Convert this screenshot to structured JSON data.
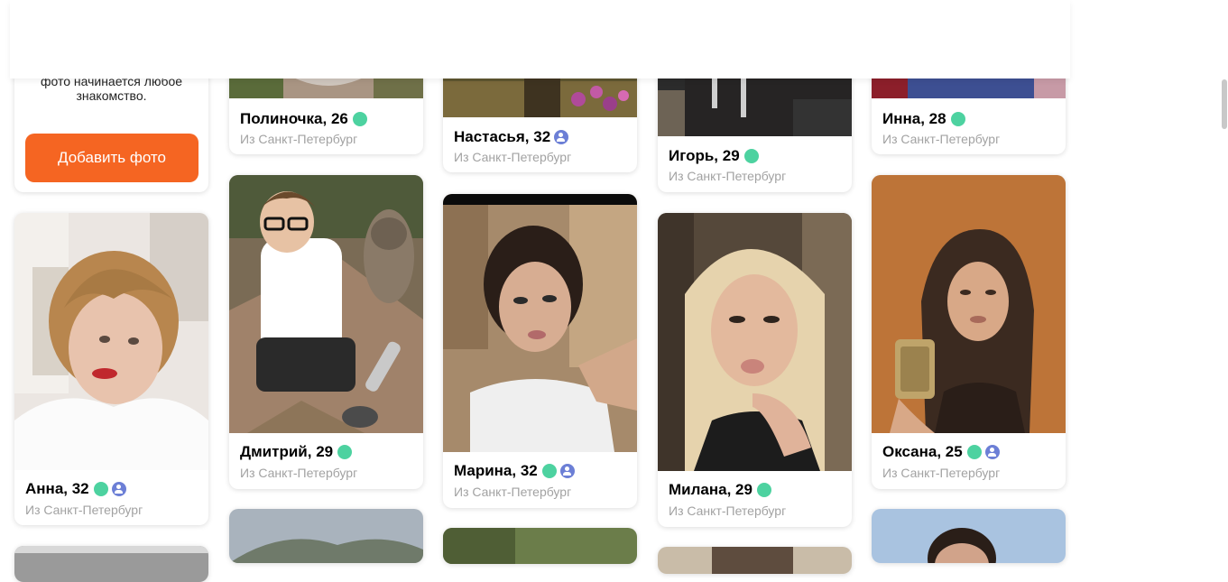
{
  "add_photo": {
    "text": "фото начинается любое знакомство.",
    "button_label": "Добавить фото"
  },
  "profiles": [
    {
      "name": "Полиночка, 26",
      "city": "Из Санкт-Петербург",
      "online": true,
      "verified": false
    },
    {
      "name": "Настасья, 32",
      "city": "Из Санкт-Петербург",
      "online": false,
      "verified": true
    },
    {
      "name": "Игорь, 29",
      "city": "Из Санкт-Петербург",
      "online": true,
      "verified": false
    },
    {
      "name": "Инна, 28",
      "city": "Из Санкт-Петербург",
      "online": true,
      "verified": false
    },
    {
      "name": "Анна, 32",
      "city": "Из Санкт-Петербург",
      "online": true,
      "verified": true
    },
    {
      "name": "Дмитрий, 29",
      "city": "Из Санкт-Петербург",
      "online": true,
      "verified": false
    },
    {
      "name": "Марина, 32",
      "city": "Из Санкт-Петербург",
      "online": true,
      "verified": true
    },
    {
      "name": "Милана, 29",
      "city": "Из Санкт-Петербург",
      "online": true,
      "verified": false
    },
    {
      "name": "Оксана, 25",
      "city": "Из Санкт-Петербург",
      "online": true,
      "verified": true
    }
  ],
  "colors": {
    "accent": "#f56522",
    "online": "#4dd2a0",
    "verified": "#6c7fd6",
    "city_text": "#a2a2a2"
  }
}
